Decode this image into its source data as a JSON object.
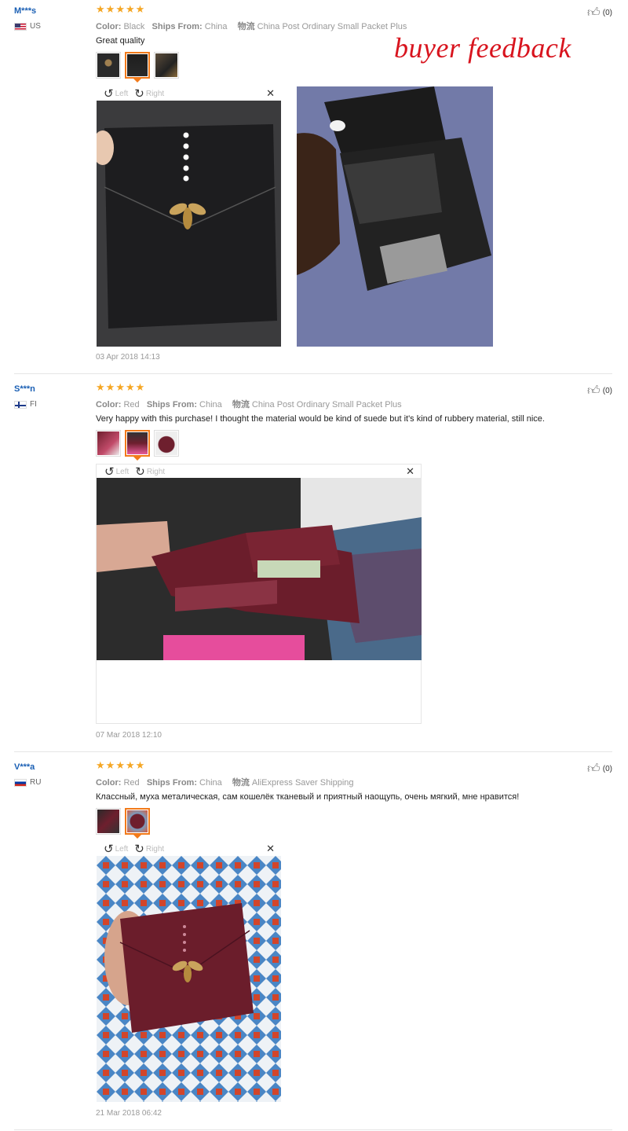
{
  "watermark": "buyer feedback",
  "colors": {
    "accent": "#f27a1a",
    "star": "#f5a623",
    "username": "#1a5fb4",
    "watermark": "#d8141e"
  },
  "icons": {
    "star": "star-icon",
    "rotate_left": "rotate-left-icon",
    "rotate_right": "rotate-right-icon",
    "close": "close-icon",
    "thumbs_up": "thumbs-up-icon"
  },
  "reviews": [
    {
      "user": "M***s",
      "country": "US",
      "rating": 5,
      "color_label": "Color:",
      "color_value": "Black",
      "ships_label": "Ships From:",
      "ships_value": "China",
      "shipping_label": "物流",
      "shipping_value": "China Post Ordinary Small Packet Plus",
      "text": "Great quality",
      "helpful": "(0)",
      "rotate_left": "Left",
      "rotate_right": "Right",
      "date": "03 Apr 2018 14:13"
    },
    {
      "user": "S***n",
      "country": "FI",
      "rating": 5,
      "color_label": "Color:",
      "color_value": "Red",
      "ships_label": "Ships From:",
      "ships_value": "China",
      "shipping_label": "物流",
      "shipping_value": "China Post Ordinary Small Packet Plus",
      "text": "Very happy with this purchase! I thought the material would be kind of suede but it's kind of rubbery material, still nice.",
      "helpful": "(0)",
      "rotate_left": "Left",
      "rotate_right": "Right",
      "date": "07 Mar 2018 12:10"
    },
    {
      "user": "V***a",
      "country": "RU",
      "rating": 5,
      "color_label": "Color:",
      "color_value": "Red",
      "ships_label": "Ships From:",
      "ships_value": "China",
      "shipping_label": "物流",
      "shipping_value": "AliExpress Saver Shipping",
      "text": "Классный, муха металическая, сам кошелёк тканевый и приятный наощупь, очень мягкий, мне нравится!",
      "helpful": "(0)",
      "rotate_left": "Left",
      "rotate_right": "Right",
      "date": "21 Mar 2018 06:42"
    }
  ]
}
